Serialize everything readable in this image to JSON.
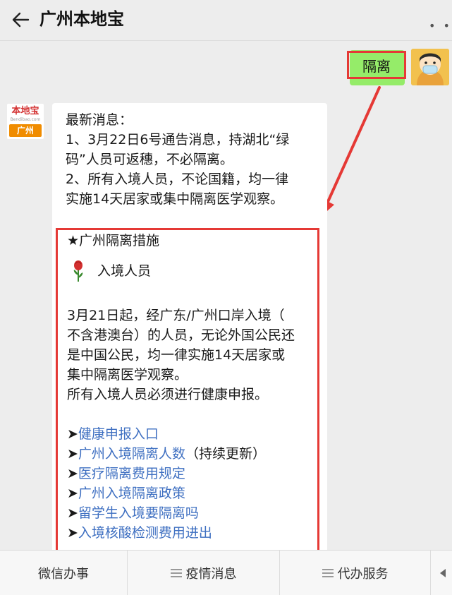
{
  "header": {
    "title": "广州本地宝",
    "more": "• •"
  },
  "user_message": {
    "text": "隔离"
  },
  "bot": {
    "avatar_logo": "本地宝",
    "avatar_url": "Bendibao.com",
    "avatar_city": "广州",
    "intro_lines": [
      "最新消息：",
      "1、3月22日6号通告消息，持湖北“绿",
      "码”人员可返穗，不必隔离。",
      "2、所有入境人员，不论国籍，均一律",
      "实施14天居家或集中隔离医学观察。"
    ],
    "section_title": "★广州隔离措施",
    "subsection": "入境人员",
    "body_lines": [
      "3月21日起，经广东/广州口岸入境（",
      "不含港澳台）的人员，无论外国公民还",
      "是中国公民，均一律实施14天居家或",
      "集中隔离医学观察。",
      "所有入境人员必须进行健康申报。"
    ],
    "links": [
      {
        "arrow": "➤",
        "text": "健康申报入口",
        "suffix": ""
      },
      {
        "arrow": "➤",
        "text": "广州入境隔离人数",
        "suffix": "（持续更新）"
      },
      {
        "arrow": "➤",
        "text": "医疗隔离费用规定",
        "suffix": ""
      },
      {
        "arrow": "➤",
        "text": "广州入境隔离政策",
        "suffix": ""
      },
      {
        "arrow": "➤",
        "text": "留学生入境要隔离吗",
        "suffix": ""
      },
      {
        "arrow": "➤",
        "text": "入境核酸检测费用进出",
        "suffix": ""
      }
    ]
  },
  "bottom_menu": {
    "items": [
      "微信办事",
      "疫情消息",
      "代办服务"
    ]
  },
  "colors": {
    "accent_red": "#e53935",
    "bubble_green": "#95ec69",
    "link_blue": "#3e6fc1"
  }
}
